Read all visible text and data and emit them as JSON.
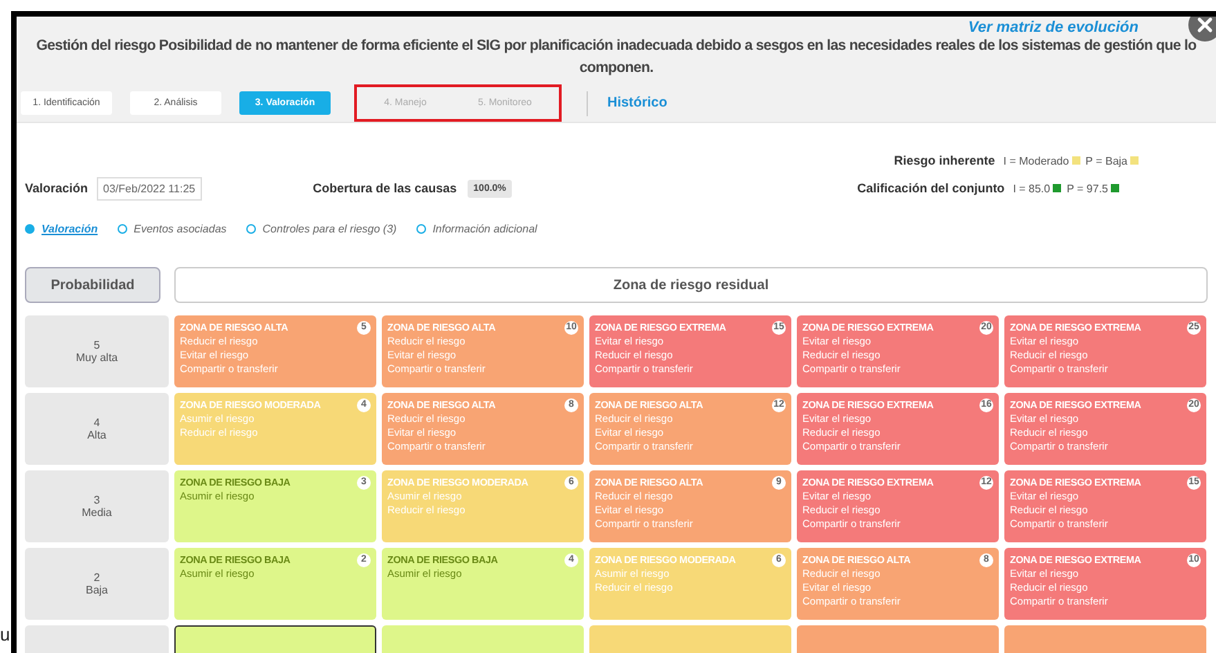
{
  "header": {
    "evolution_link": "Ver matriz de evolución",
    "title_lines": [
      "Gestión del riesgo Posibilidad de no mantener de forma eficiente el SIG por planificación inadecuada debido a sesgos en las necesidades reales de los sistemas de gestión que lo",
      "componen."
    ]
  },
  "steps": [
    {
      "label": "1. Identificación",
      "selected": false,
      "disabled": false,
      "highlighted": false
    },
    {
      "label": "2. Análisis",
      "selected": false,
      "disabled": false,
      "highlighted": false
    },
    {
      "label": "3. Valoración",
      "selected": true,
      "disabled": false,
      "highlighted": false
    },
    {
      "label": "4. Manejo",
      "selected": false,
      "disabled": true,
      "highlighted": true
    },
    {
      "label": "5. Monitoreo",
      "selected": false,
      "disabled": true,
      "highlighted": true
    }
  ],
  "history_link": "Histórico",
  "summary": {
    "inherent": {
      "label": "Riesgo inherente",
      "indicators": [
        {
          "text": "I = Moderado",
          "color": "#f3e27e"
        },
        {
          "text": "P = Baja",
          "color": "#f3e27e"
        }
      ]
    },
    "valuation": {
      "label": "Valoración",
      "value": "03/Feb/2022 11:25"
    },
    "coverage": {
      "label": "Cobertura de las causas",
      "value": "100.0%"
    },
    "overall": {
      "label": "Calificación del conjunto",
      "indicators": [
        {
          "text": "I = 85.0",
          "color": "#1f9a2e"
        },
        {
          "text": "P = 97.5",
          "color": "#1f9a2e"
        }
      ]
    }
  },
  "sections": [
    {
      "label": "Valoración",
      "selected": true
    },
    {
      "label": "Eventos asociadas",
      "selected": false
    },
    {
      "label": "Controles para el riesgo (3)",
      "selected": false
    },
    {
      "label": "Información adicional",
      "selected": false
    }
  ],
  "axis_button": "Probabilidad",
  "matrix_title": "Zona de riesgo residual",
  "rows": [
    {
      "number": "5",
      "label": "Muy alta",
      "cells": [
        {
          "zone": "ZONA DE RIESGO ALTA",
          "score": "5",
          "actions": [
            "Reducir el riesgo",
            "Evitar el riesgo",
            "Compartir o transferir"
          ],
          "color": "#f8a473",
          "selected": false
        },
        {
          "zone": "ZONA DE RIESGO ALTA",
          "score": "10",
          "actions": [
            "Reducir el riesgo",
            "Evitar el riesgo",
            "Compartir o transferir"
          ],
          "color": "#f8a473",
          "selected": false
        },
        {
          "zone": "ZONA DE RIESGO EXTREMA",
          "score": "15",
          "actions": [
            "Evitar el riesgo",
            "Reducir el riesgo",
            "Compartir o transferir"
          ],
          "color": "#f47a7a",
          "selected": false
        },
        {
          "zone": "ZONA DE RIESGO EXTREMA",
          "score": "20",
          "actions": [
            "Evitar el riesgo",
            "Reducir el riesgo",
            "Compartir o transferir"
          ],
          "color": "#f47a7a",
          "selected": false
        },
        {
          "zone": "ZONA DE RIESGO EXTREMA",
          "score": "25",
          "actions": [
            "Evitar el riesgo",
            "Reducir el riesgo",
            "Compartir o transferir"
          ],
          "color": "#f47a7a",
          "selected": false
        }
      ]
    },
    {
      "number": "4",
      "label": "Alta",
      "cells": [
        {
          "zone": "ZONA DE RIESGO MODERADA",
          "score": "4",
          "actions": [
            "Asumir el riesgo",
            "Reducir el riesgo"
          ],
          "color": "#f7d977",
          "selected": false
        },
        {
          "zone": "ZONA DE RIESGO ALTA",
          "score": "8",
          "actions": [
            "Reducir el riesgo",
            "Evitar el riesgo",
            "Compartir o transferir"
          ],
          "color": "#f8a473",
          "selected": false
        },
        {
          "zone": "ZONA DE RIESGO ALTA",
          "score": "12",
          "actions": [
            "Reducir el riesgo",
            "Evitar el riesgo",
            "Compartir o transferir"
          ],
          "color": "#f8a473",
          "selected": false
        },
        {
          "zone": "ZONA DE RIESGO EXTREMA",
          "score": "16",
          "actions": [
            "Evitar el riesgo",
            "Reducir el riesgo",
            "Compartir o transferir"
          ],
          "color": "#f47a7a",
          "selected": false
        },
        {
          "zone": "ZONA DE RIESGO EXTREMA",
          "score": "20",
          "actions": [
            "Evitar el riesgo",
            "Reducir el riesgo",
            "Compartir o transferir"
          ],
          "color": "#f47a7a",
          "selected": false
        }
      ]
    },
    {
      "number": "3",
      "label": "Media",
      "cells": [
        {
          "zone": "ZONA DE RIESGO BAJA",
          "score": "3",
          "actions": [
            "Asumir el riesgo"
          ],
          "color": "#def68a",
          "selected": false
        },
        {
          "zone": "ZONA DE RIESGO MODERADA",
          "score": "6",
          "actions": [
            "Asumir el riesgo",
            "Reducir el riesgo"
          ],
          "color": "#f7d977",
          "selected": false
        },
        {
          "zone": "ZONA DE RIESGO ALTA",
          "score": "9",
          "actions": [
            "Reducir el riesgo",
            "Evitar el riesgo",
            "Compartir o transferir"
          ],
          "color": "#f8a473",
          "selected": false
        },
        {
          "zone": "ZONA DE RIESGO EXTREMA",
          "score": "12",
          "actions": [
            "Evitar el riesgo",
            "Reducir el riesgo",
            "Compartir o transferir"
          ],
          "color": "#f47a7a",
          "selected": false
        },
        {
          "zone": "ZONA DE RIESGO EXTREMA",
          "score": "15",
          "actions": [
            "Evitar el riesgo",
            "Reducir el riesgo",
            "Compartir o transferir"
          ],
          "color": "#f47a7a",
          "selected": false
        }
      ]
    },
    {
      "number": "2",
      "label": "Baja",
      "cells": [
        {
          "zone": "ZONA DE RIESGO BAJA",
          "score": "2",
          "actions": [
            "Asumir el riesgo"
          ],
          "color": "#def68a",
          "selected": false
        },
        {
          "zone": "ZONA DE RIESGO BAJA",
          "score": "4",
          "actions": [
            "Asumir el riesgo"
          ],
          "color": "#def68a",
          "selected": false
        },
        {
          "zone": "ZONA DE RIESGO MODERADA",
          "score": "6",
          "actions": [
            "Asumir el riesgo",
            "Reducir el riesgo"
          ],
          "color": "#f7d977",
          "selected": false
        },
        {
          "zone": "ZONA DE RIESGO ALTA",
          "score": "8",
          "actions": [
            "Reducir el riesgo",
            "Evitar el riesgo",
            "Compartir o transferir"
          ],
          "color": "#f8a473",
          "selected": false
        },
        {
          "zone": "ZONA DE RIESGO EXTREMA",
          "score": "10",
          "actions": [
            "Evitar el riesgo",
            "Reducir el riesgo",
            "Compartir o transferir"
          ],
          "color": "#f47a7a",
          "selected": false
        }
      ]
    },
    {
      "cells": [
        {
          "color": "#def68a",
          "selected": true
        },
        {
          "color": "#def68a",
          "selected": false
        },
        {
          "color": "#f7d977",
          "selected": false
        },
        {
          "color": "#f8a473",
          "selected": false
        },
        {
          "color": "#f8a473",
          "selected": false
        }
      ]
    }
  ],
  "side_text": "u"
}
